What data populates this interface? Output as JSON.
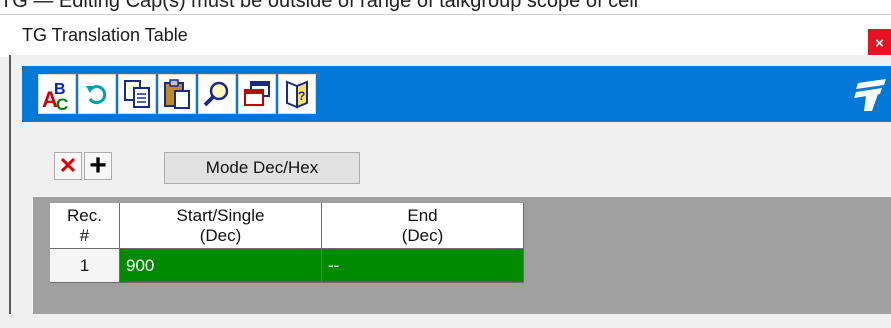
{
  "background_text": "TG — Editing Cap(s) must be outside of range of talkgroup scope of cell",
  "window": {
    "title": "TG Translation Table",
    "close_glyph": "×"
  },
  "toolbar": {
    "icons": [
      "spell-check-icon",
      "undo-icon",
      "copy-icon",
      "paste-icon",
      "find-icon",
      "window-icon",
      "help-book-icon"
    ],
    "accent_color": "#0078d7"
  },
  "actions": {
    "delete_glyph": "✕",
    "add_glyph": "+",
    "mode_label": "Mode Dec/Hex"
  },
  "table": {
    "headers": [
      {
        "line1": "Rec.",
        "line2": "#"
      },
      {
        "line1": "Start/Single",
        "line2": "(Dec)"
      },
      {
        "line1": "End",
        "line2": "(Dec)"
      }
    ],
    "rows": [
      {
        "rec": "1",
        "start": "900",
        "end": "--"
      }
    ],
    "row_color": "#008a00"
  }
}
